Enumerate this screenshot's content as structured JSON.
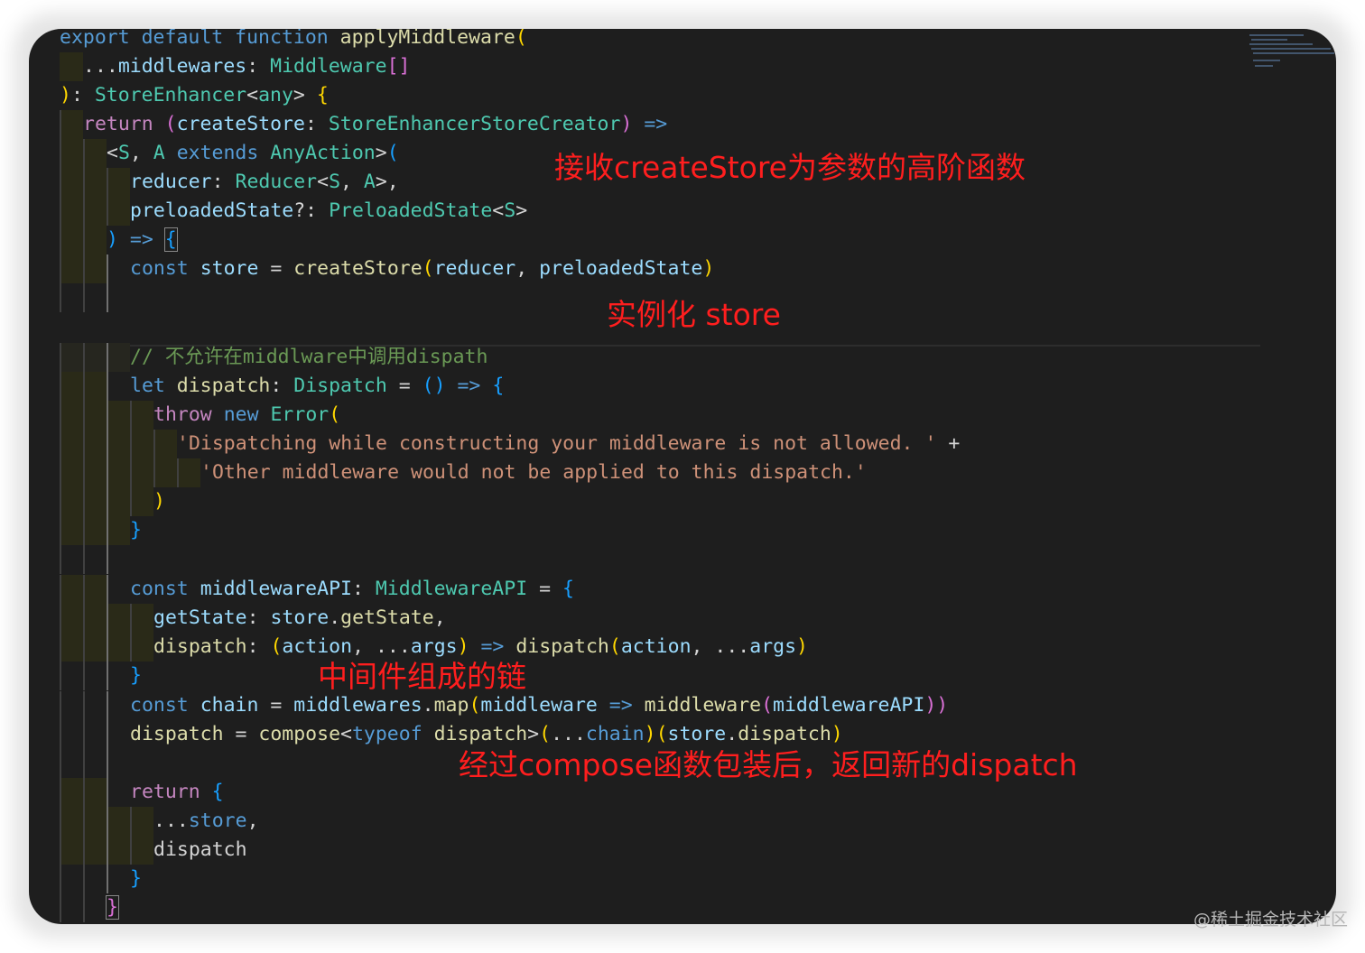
{
  "annotations": {
    "note1": "接收createStore为参数的高阶函数",
    "note2": "实例化 store",
    "note3": "中间件组成的链",
    "note4": "经过compose函数包装后，返回新的dispatch"
  },
  "watermark": "@稀土掘金技术社区",
  "code": {
    "l1": {
      "a": "export",
      "b": " default ",
      "c": "function",
      "d": " applyMiddleware",
      "e": "("
    },
    "l2": {
      "a": "...",
      "b": "middlewares",
      "c": ": ",
      "d": "Middleware",
      "e": "[]"
    },
    "l3": {
      "a": ")",
      "b": ": ",
      "c": "StoreEnhancer",
      "d": "<",
      "e": "any",
      "f": "> ",
      "g": "{"
    },
    "l4": {
      "a": "return",
      "b": " (",
      "c": "createStore",
      "d": ": ",
      "e": "StoreEnhancerStoreCreator",
      "f": ")",
      "g": " =>"
    },
    "l5": {
      "a": "<",
      "b": "S",
      "c": ", ",
      "d": "A",
      "e": " extends ",
      "f": "AnyAction",
      "g": ">",
      "h": "("
    },
    "l6": {
      "a": "reducer",
      "b": ": ",
      "c": "Reducer",
      "d": "<",
      "e": "S",
      "f": ", ",
      "g": "A",
      "h": ">,"
    },
    "l7": {
      "a": "preloadedState",
      "b": "?: ",
      "c": "PreloadedState",
      "d": "<",
      "e": "S",
      "f": ">"
    },
    "l8": {
      "a": ")",
      "b": " => ",
      "c": "{"
    },
    "l9": {
      "a": "const",
      "b": " ",
      "c": "store",
      "d": " = ",
      "e": "createStore",
      "f": "(",
      "g": "reducer",
      "h": ", ",
      "i": "preloadedState",
      "j": ")"
    },
    "l10": {
      "a": "// 不允许在middlware中调用dispath"
    },
    "l11": {
      "a": "let",
      "b": " ",
      "c": "dispatch",
      "d": ": ",
      "e": "Dispatch",
      "f": " = ",
      "g": "()",
      "h": " => ",
      "i": "{"
    },
    "l12": {
      "a": "throw",
      "b": " ",
      "c": "new",
      "d": " ",
      "e": "Error",
      "f": "("
    },
    "l13": {
      "a": "'Dispatching while constructing your middleware is not allowed. '",
      "b": " +"
    },
    "l14": {
      "a": "'Other middleware would not be applied to this dispatch.'"
    },
    "l15": {
      "a": ")"
    },
    "l16": {
      "a": "}"
    },
    "l17": {
      "a": "const",
      "b": " ",
      "c": "middlewareAPI",
      "d": ": ",
      "e": "MiddlewareAPI",
      "f": " = ",
      "g": "{"
    },
    "l18": {
      "a": "getState",
      "b": ": ",
      "c": "store",
      "d": ".",
      "e": "getState",
      "f": ","
    },
    "l19": {
      "a": "dispatch",
      "b": ": ",
      "c": "(",
      "d": "action",
      "e": ", ...",
      "f": "args",
      "g": ")",
      "h": " => ",
      "i": "dispatch",
      "j": "(",
      "k": "action",
      "l": ", ...",
      "m": "args",
      "n": ")"
    },
    "l20": {
      "a": "}"
    },
    "l21": {
      "a": "const",
      "b": " ",
      "c": "chain",
      "d": " = ",
      "e": "middlewares",
      "f": ".",
      "g": "map",
      "h": "(",
      "i": "middleware",
      "j": " => ",
      "k": "middleware",
      "l": "(",
      "m": "middlewareAPI",
      "n": "))"
    },
    "l22": {
      "a": "dispatch",
      "b": " = ",
      "c": "compose",
      "d": "<",
      "e": "typeof",
      "f": " ",
      "g": "dispatch",
      "h": ">",
      "i": "(",
      "j": "...",
      "k": "chain",
      "l": ")(",
      "m": "store",
      "n": ".",
      "o": "dispatch",
      "p": ")"
    },
    "l23": {
      "a": "return",
      "b": " ",
      "c": "{"
    },
    "l24": {
      "a": "...",
      "b": "store",
      "c": ","
    },
    "l25": {
      "a": "dispatch"
    },
    "l26": {
      "a": "}"
    },
    "l27": {
      "a": "}"
    }
  }
}
